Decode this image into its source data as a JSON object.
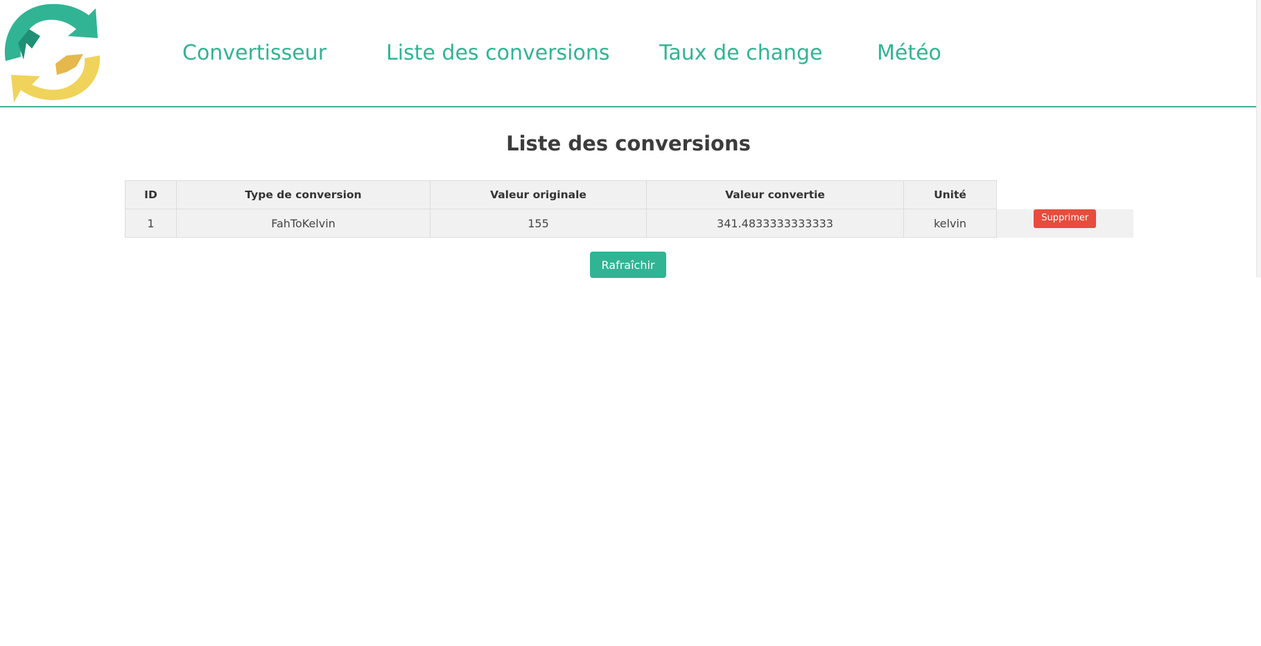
{
  "nav": {
    "items": [
      {
        "label": "Convertisseur"
      },
      {
        "label": "Liste des conversions"
      },
      {
        "label": "Taux de change"
      },
      {
        "label": "Météo"
      }
    ]
  },
  "main": {
    "title": "Liste des conversions",
    "table": {
      "headers": [
        "ID",
        "Type de conversion",
        "Valeur originale",
        "Valeur convertie",
        "Unité"
      ],
      "rows": [
        {
          "id": "1",
          "type": "FahToKelvin",
          "original": "155",
          "converted": "341.4833333333333",
          "unit": "kelvin",
          "delete_label": "Supprimer"
        }
      ]
    },
    "refresh_label": "Rafraîchir"
  },
  "colors": {
    "accent": "#31b494",
    "danger": "#e74c3c",
    "logo_yellow": "#f0d35a",
    "table_bg": "#f1f1f1"
  },
  "icons": {
    "logo": "refresh-arrows-icon"
  }
}
